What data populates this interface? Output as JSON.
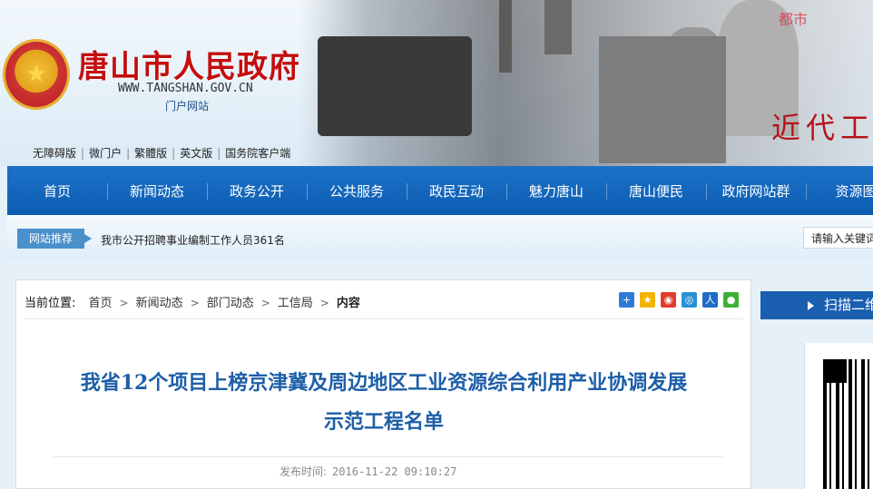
{
  "header": {
    "emblem_glyph": "★",
    "site_name": "唐山市人民政府",
    "url": "WWW.TANGSHAN.GOV.CN",
    "subtitle": "门户网站",
    "banner_text": "近代工",
    "banner_text_top": "都市",
    "top_links": [
      "无障碍版",
      "微门户",
      "繁體版",
      "英文版",
      "国务院客户端"
    ]
  },
  "nav": {
    "items": [
      "首页",
      "新闻动态",
      "政务公开",
      "公共服务",
      "政民互动",
      "魅力唐山",
      "唐山便民",
      "政府网站群",
      "资源图"
    ]
  },
  "recommend": {
    "tag": "网站推荐",
    "text": "我市公开招聘事业编制工作人员361名",
    "search_text": "请输入关键词"
  },
  "breadcrumb": {
    "label": "当前位置:",
    "items": [
      "首页",
      "新闻动态",
      "部门动态",
      "工信局",
      "内容"
    ]
  },
  "share": {
    "icons": [
      "plus-share-icon",
      "qzone-icon",
      "weibo-icon",
      "tencent-weibo-icon",
      "renren-icon",
      "wechat-icon"
    ],
    "colors": [
      "#2d7bd6",
      "#f0b400",
      "#e23c2c",
      "#2a8fd6",
      "#1e6ec7",
      "#3cb034"
    ]
  },
  "article": {
    "title_line1": "我省12个项目上榜京津冀及周边地区工业资源综合利用产业协调发展",
    "title_line2": "示范工程名单",
    "publish_label": "发布时间:",
    "publish_time": "2016-11-22 09:10:27"
  },
  "sidebar": {
    "qr_title": "扫描二维码"
  },
  "colors": {
    "nav_blue": "#0c5db2",
    "title_blue": "#1d5ea8",
    "site_red": "#c40d0d"
  }
}
